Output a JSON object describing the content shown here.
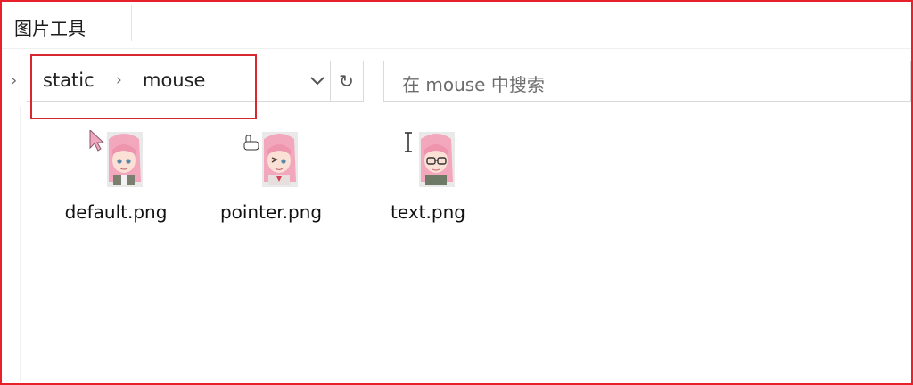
{
  "ribbon": {
    "tab_label": "图片工具"
  },
  "address": {
    "crumbs": [
      "static",
      "mouse"
    ],
    "separator": "›",
    "left_chevron": "›",
    "refresh_glyph": "↻"
  },
  "search": {
    "placeholder": "在 mouse 中搜索"
  },
  "files": [
    {
      "name": "default.png",
      "cursor_icon": "arrow-cursor-icon"
    },
    {
      "name": "pointer.png",
      "cursor_icon": "hand-cursor-icon"
    },
    {
      "name": "text.png",
      "cursor_icon": "text-cursor-icon"
    }
  ],
  "colors": {
    "highlight": "#d8282f",
    "frame": "#e8202a",
    "hair": "#f2a7bd",
    "skin": "#fbe1d5"
  }
}
